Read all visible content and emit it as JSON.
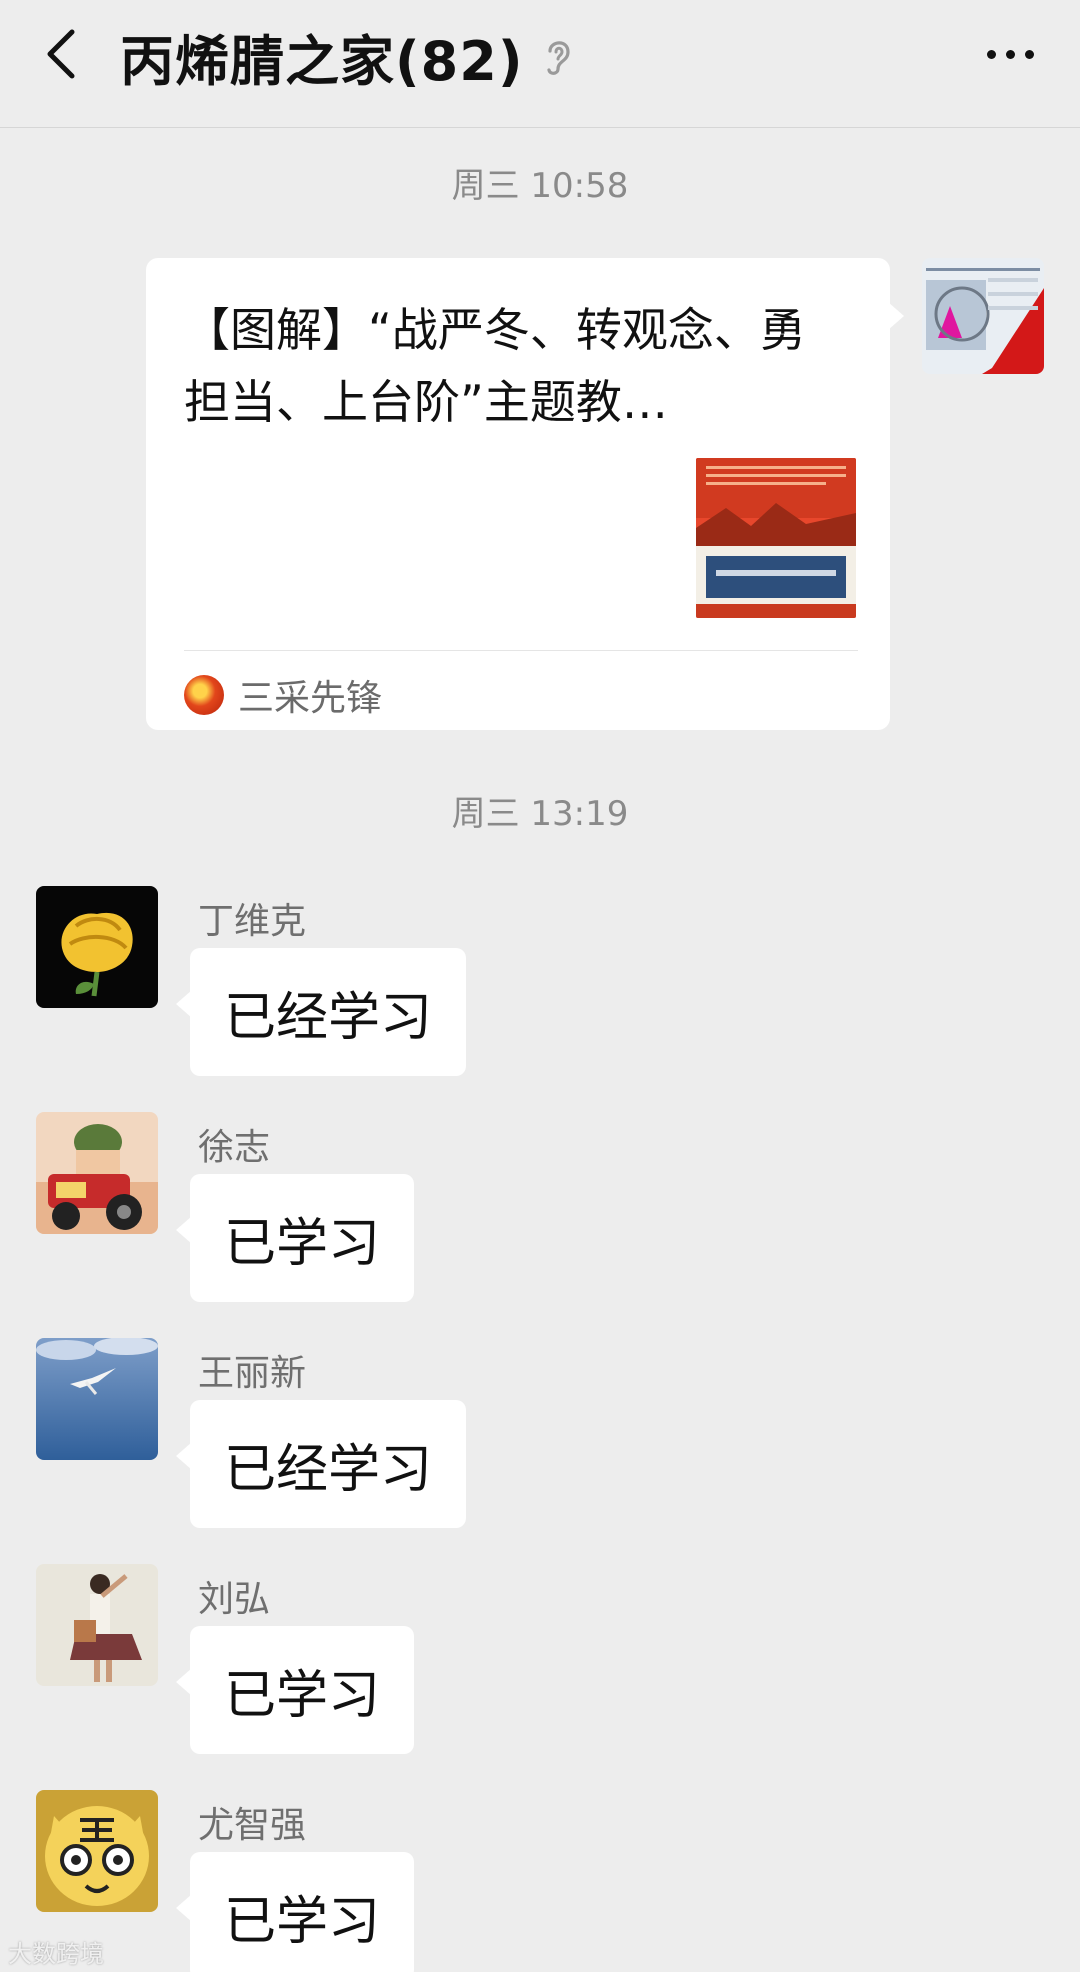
{
  "header": {
    "title": "丙烯腈之家(82)",
    "back_icon": "chevron-left-icon",
    "mute_icon": "ear-icon",
    "more_icon": "more-dots-icon"
  },
  "chat": {
    "time_1": "周三 10:58",
    "article": {
      "title": "【图解】“战严冬、转观念、勇担当、上台阶”主题教…",
      "source": "三采先锋"
    },
    "time_2": "周三 13:19",
    "messages": [
      {
        "sender": "丁维克",
        "text": "已经学习",
        "avatar": "yellow-rose"
      },
      {
        "sender": "徐志",
        "text": "已学习",
        "avatar": "cartoon-tractor"
      },
      {
        "sender": "王丽新",
        "text": "已经学习",
        "avatar": "seagull-sky"
      },
      {
        "sender": "刘弘",
        "text": "已学习",
        "avatar": "illustrated-woman"
      },
      {
        "sender": "尤智强",
        "text": "已学习",
        "avatar": "tiger-cartoon"
      }
    ]
  },
  "watermark": "大数跨境",
  "colors": {
    "background": "#ededed",
    "bubble": "#ffffff",
    "time_text": "#8a8a8a"
  }
}
